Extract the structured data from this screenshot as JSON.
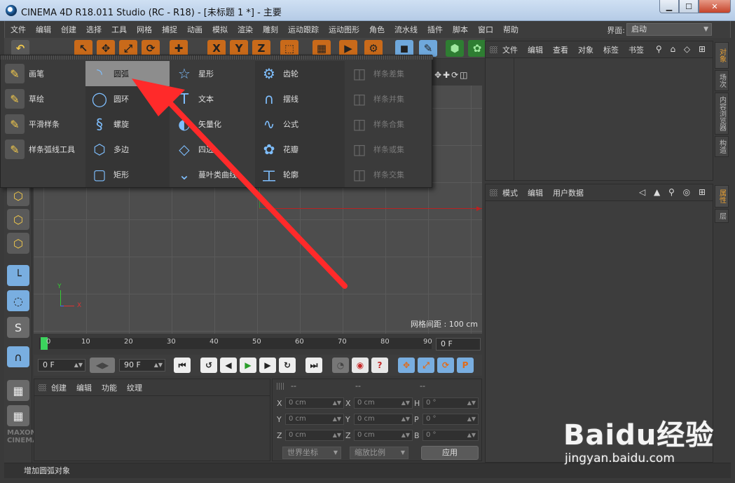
{
  "window": {
    "title": "CINEMA 4D R18.011 Studio (RC - R18) - [未标题 1 *] - 主要",
    "min_label": "▁",
    "max_label": "☐",
    "close_label": "✕"
  },
  "menubar": {
    "items": [
      "文件",
      "编辑",
      "创建",
      "选择",
      "工具",
      "网格",
      "捕捉",
      "动画",
      "模拟",
      "渲染",
      "雕刻",
      "运动跟踪",
      "运动图形",
      "角色",
      "流水线",
      "插件",
      "脚本",
      "窗口",
      "帮助"
    ],
    "layout_label": "界面:",
    "layout_value": "启动"
  },
  "spline_menu": {
    "col1": [
      {
        "label": "画笔",
        "icon": "pen-icon",
        "glyph": "✎"
      },
      {
        "label": "草绘",
        "icon": "sketch-icon",
        "glyph": "✎"
      },
      {
        "label": "平滑样条",
        "icon": "smooth-spline-icon",
        "glyph": "✎"
      },
      {
        "label": "样条弧线工具",
        "icon": "spline-arc-tool-icon",
        "glyph": "✎"
      }
    ],
    "col2": [
      {
        "label": "圆弧",
        "icon": "arc-icon",
        "glyph": "◝"
      },
      {
        "label": "圆环",
        "icon": "circle-icon",
        "glyph": "◯"
      },
      {
        "label": "螺旋",
        "icon": "helix-icon",
        "glyph": "§"
      },
      {
        "label": "多边",
        "icon": "polygon-icon",
        "glyph": "⬡"
      },
      {
        "label": "矩形",
        "icon": "rectangle-icon",
        "glyph": "▢"
      }
    ],
    "col3": [
      {
        "label": "星形",
        "icon": "star-icon",
        "glyph": "☆"
      },
      {
        "label": "文本",
        "icon": "text-icon",
        "glyph": "T"
      },
      {
        "label": "矢量化",
        "icon": "vectorizer-icon",
        "glyph": "◐"
      },
      {
        "label": "四边",
        "icon": "four-side-icon",
        "glyph": "◇"
      },
      {
        "label": "蔓叶类曲线",
        "icon": "cissoid-icon",
        "glyph": "⌄"
      }
    ],
    "col4": [
      {
        "label": "齿轮",
        "icon": "cog-icon",
        "glyph": "⚙"
      },
      {
        "label": "摆线",
        "icon": "cycloid-icon",
        "glyph": "∩"
      },
      {
        "label": "公式",
        "icon": "formula-icon",
        "glyph": "∿"
      },
      {
        "label": "花瓣",
        "icon": "flower-icon",
        "glyph": "✿"
      },
      {
        "label": "轮廓",
        "icon": "profile-icon",
        "glyph": "工"
      }
    ],
    "col5": [
      {
        "label": "样条差集",
        "icon": "spline-subtract-icon",
        "glyph": "◫"
      },
      {
        "label": "样条并集",
        "icon": "spline-union-icon",
        "glyph": "◫"
      },
      {
        "label": "样条合集",
        "icon": "spline-and-icon",
        "glyph": "◫"
      },
      {
        "label": "样条或集",
        "icon": "spline-or-icon",
        "glyph": "◫"
      },
      {
        "label": "样条交集",
        "icon": "spline-intersect-icon",
        "glyph": "◫"
      }
    ]
  },
  "objects_panel": {
    "menu": [
      "文件",
      "编辑",
      "查看",
      "对象",
      "标签",
      "书签"
    ],
    "icons": "⚲ ⌂ ◇ ⊞"
  },
  "attributes_panel": {
    "menu": [
      "模式",
      "编辑",
      "用户数据"
    ],
    "icons": "◁ ▲ ⚲ ◎ ⊞"
  },
  "side_tabs": {
    "top": [
      "对象",
      "场次",
      "内容浏览器",
      "构造"
    ],
    "bottom": [
      "属性",
      "层"
    ]
  },
  "viewport": {
    "grid_spacing": "网格间距 : 100 cm",
    "axis_y": "Y",
    "axis_x": "X",
    "nav_icons": "✥✚⟳◫"
  },
  "timeline": {
    "ticks": [
      "0",
      "10",
      "20",
      "30",
      "40",
      "50",
      "60",
      "70",
      "80",
      "90"
    ],
    "current_frame": "0 F"
  },
  "transport": {
    "start_frame": "0 F",
    "end_frame": "90 F"
  },
  "materials_panel": {
    "menu": [
      "创建",
      "编辑",
      "功能",
      "纹理"
    ]
  },
  "coords_panel": {
    "headers": [
      "--",
      "--",
      "--"
    ],
    "rows": [
      {
        "a": "X",
        "av": "0 cm",
        "b": "X",
        "bv": "0 cm",
        "c": "H",
        "cv": "0 °"
      },
      {
        "a": "Y",
        "av": "0 cm",
        "b": "Y",
        "bv": "0 cm",
        "c": "P",
        "cv": "0 °"
      },
      {
        "a": "Z",
        "av": "0 cm",
        "b": "Z",
        "bv": "0 cm",
        "c": "B",
        "cv": "0 °"
      }
    ],
    "coord_system": "世界坐标",
    "scale_mode": "缩放比例",
    "apply_label": "应用"
  },
  "left_logo": "MAXON CINEMA",
  "status_text": "增加圆弧对象",
  "watermark": {
    "brand": "Baidu经验",
    "url": "jingyan.baidu.com"
  }
}
